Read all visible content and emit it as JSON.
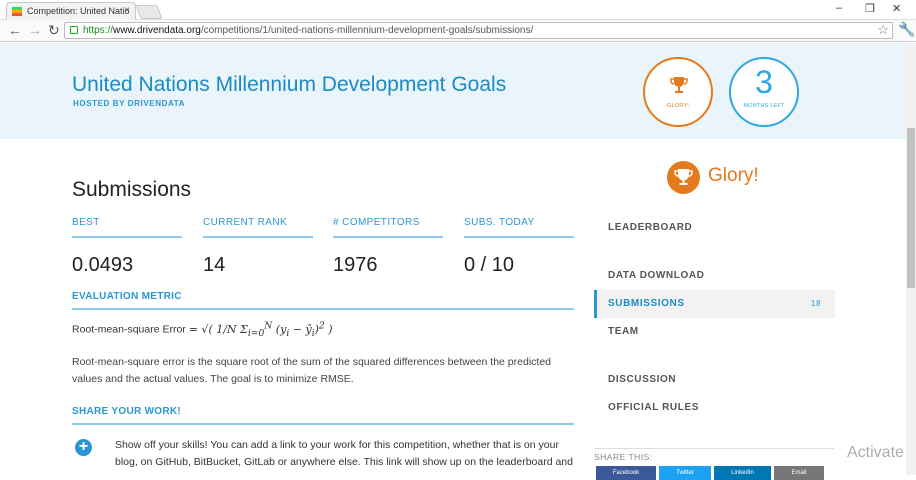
{
  "browser": {
    "tab_title": "Competition: United Natio",
    "tab_close": "×",
    "url_https": "https://",
    "url_domain": "www.drivendata.org",
    "url_path": "/competitions/1/united-nations-millennium-development-goals/submissions/"
  },
  "header": {
    "title": "United Nations Millennium Development Goals",
    "hosted_by": "HOSTED BY DRIVENDATA",
    "glory_label": "GLORY!",
    "months_value": "3",
    "months_label": "MONTHS LEFT"
  },
  "submissions": {
    "title": "Submissions",
    "stats": [
      {
        "label": "BEST",
        "value": "0.0493"
      },
      {
        "label": "CURRENT RANK",
        "value": "14"
      },
      {
        "label": "# COMPETITORS",
        "value": "1976"
      },
      {
        "label": "SUBS. TODAY",
        "value": "0 / 10"
      }
    ],
    "eval_heading": "EVALUATION METRIC",
    "formula_label": "Root-mean-square Error",
    "eval_description": "Root-mean-square error is the square root of the sum of the squared differences between the predicted values and the actual values. The goal is to minimize RMSE.",
    "share_heading": "SHARE YOUR WORK!",
    "share_text": "Show off your skills! You can add a link to your work for this competition, whether that is on your blog, on GitHub, BitBucket, GitLab or anywhere else. This link will show up on the leaderboard and"
  },
  "sidebar": {
    "prize": "Glory!",
    "items": [
      {
        "label": "LEADERBOARD"
      },
      {
        "label": "DATA DOWNLOAD"
      },
      {
        "label": "SUBMISSIONS",
        "badge": "18"
      },
      {
        "label": "TEAM"
      },
      {
        "label": "DISCUSSION"
      },
      {
        "label": "OFFICIAL RULES"
      }
    ],
    "share_this": "SHARE THIS:",
    "share_buttons": [
      "Facebook",
      "Twitter",
      "LinkedIn",
      "Email"
    ]
  },
  "overlay": {
    "activate": "Activate"
  },
  "colors": {
    "accent_blue": "#2a97d2",
    "accent_orange": "#e37a1b",
    "banner_bg": "#e9f5fb"
  }
}
